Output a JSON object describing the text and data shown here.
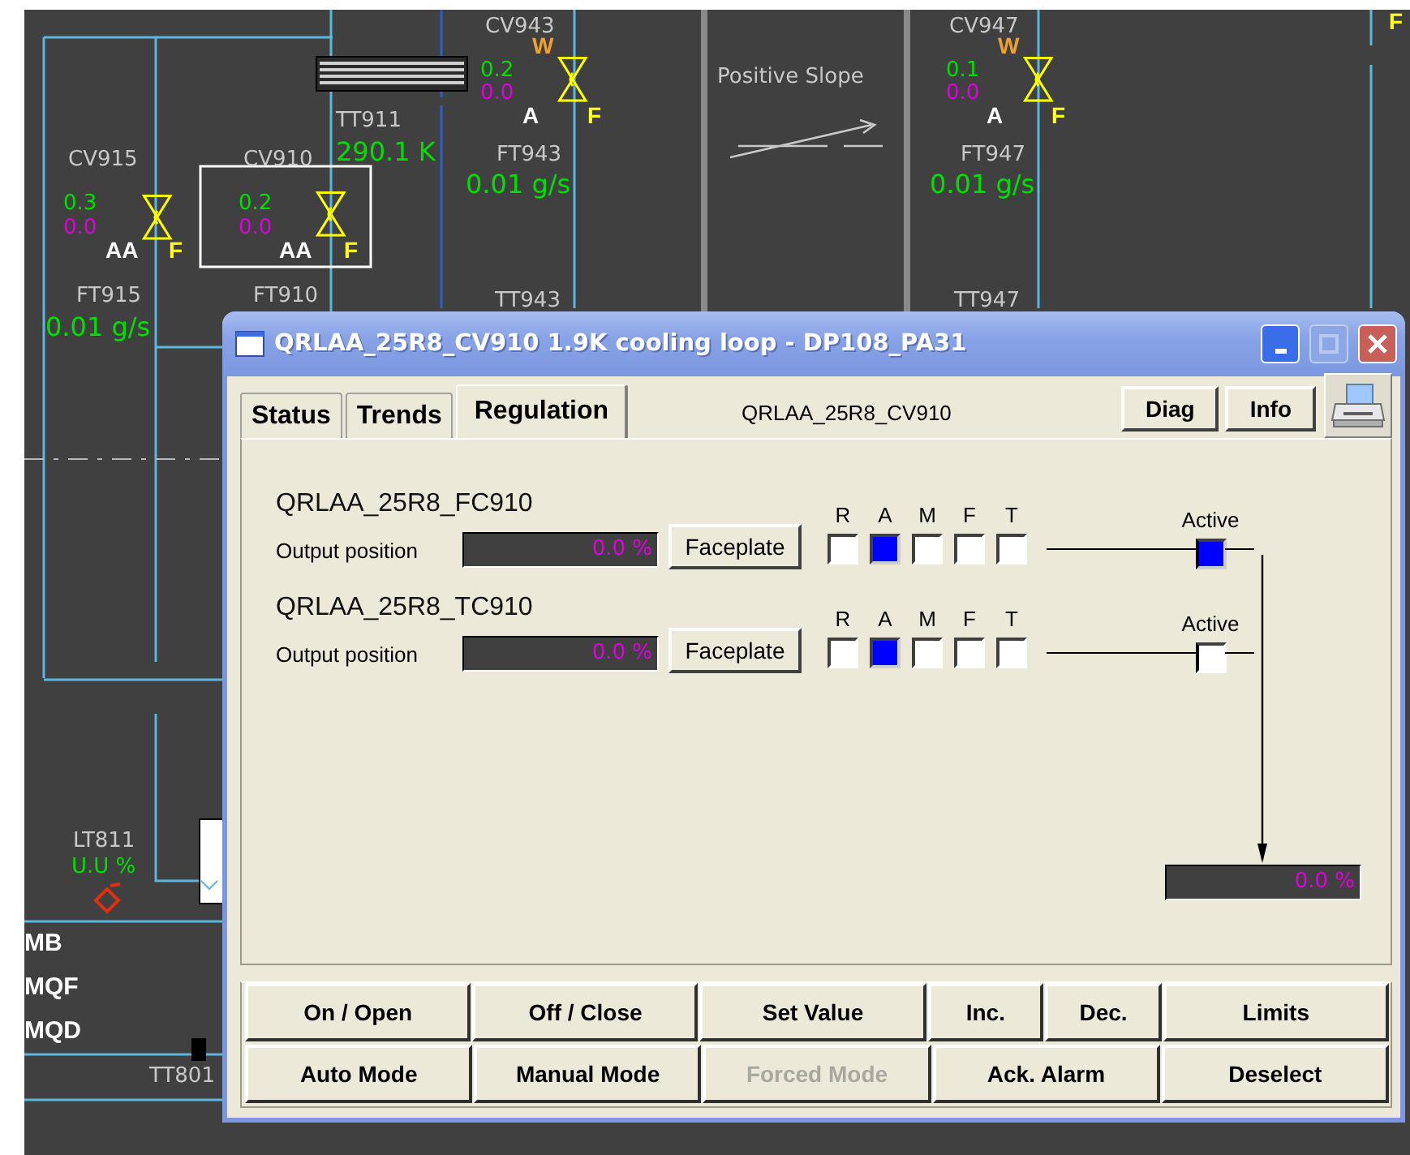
{
  "synoptic": {
    "labels": [
      {
        "kind": "tag",
        "text": "CV943"
      },
      {
        "kind": "tag",
        "text": "CV947"
      },
      {
        "kind": "fault",
        "text": "F"
      },
      {
        "kind": "warning",
        "text": "W"
      },
      {
        "kind": "warning",
        "text": "W"
      },
      {
        "kind": "reading",
        "text": "0.2"
      },
      {
        "kind": "caption",
        "text": "Positive Slope"
      },
      {
        "kind": "reading",
        "text": "0.1"
      },
      {
        "kind": "position",
        "text": "0.0"
      },
      {
        "kind": "position",
        "text": "0.0"
      },
      {
        "kind": "tag",
        "text": "TT911"
      },
      {
        "kind": "mode",
        "text": "A"
      },
      {
        "kind": "fault",
        "text": "F"
      },
      {
        "kind": "mode",
        "text": "A"
      },
      {
        "kind": "fault",
        "text": "F"
      },
      {
        "kind": "tag",
        "text": "CV915"
      },
      {
        "kind": "tag",
        "text": "CV910"
      },
      {
        "kind": "flow",
        "text": "290.1 K"
      },
      {
        "kind": "tag",
        "text": "FT943"
      },
      {
        "kind": "tag",
        "text": "FT947"
      },
      {
        "kind": "flow",
        "text": "0.01 g/s"
      },
      {
        "kind": "flow",
        "text": "0.01 g/s"
      },
      {
        "kind": "reading",
        "text": "0.3"
      },
      {
        "kind": "reading",
        "text": "0.2"
      },
      {
        "kind": "position",
        "text": "0.0"
      },
      {
        "kind": "position",
        "text": "0.0"
      },
      {
        "kind": "mode",
        "text": "AA"
      },
      {
        "kind": "fault",
        "text": "F"
      },
      {
        "kind": "mode",
        "text": "AA"
      },
      {
        "kind": "fault",
        "text": "F"
      },
      {
        "kind": "tag",
        "text": "FT915"
      },
      {
        "kind": "tag",
        "text": "FT910"
      },
      {
        "kind": "tag",
        "text": "TT943"
      },
      {
        "kind": "tag",
        "text": "TT947"
      },
      {
        "kind": "flow",
        "text": "0.01 g/s"
      },
      {
        "kind": "tag",
        "text": "LT811"
      },
      {
        "kind": "reading",
        "text": "U.U %"
      },
      {
        "kind": "section",
        "text": "MB"
      },
      {
        "kind": "section",
        "text": "MQF"
      },
      {
        "kind": "section",
        "text": "MQD"
      },
      {
        "kind": "tag",
        "text": "TT801"
      }
    ]
  },
  "window": {
    "title": "QRLAA_25R8_CV910 1.9K cooling loop - DP108_PA31",
    "maximize_disabled": true
  },
  "tabs": [
    {
      "label": "Status",
      "selected": false
    },
    {
      "label": "Trends",
      "selected": false
    },
    {
      "label": "Regulation",
      "selected": true
    }
  ],
  "object_name": "QRLAA_25R8_CV910",
  "header_buttons": [
    "Diag",
    "Info"
  ],
  "controllers": [
    {
      "name": "QRLAA_25R8_FC910",
      "output_label": "Output position",
      "output_value": "0.0 %",
      "button": "Faceplate",
      "modes": [
        {
          "label": "R",
          "on": false
        },
        {
          "label": "A",
          "on": true
        },
        {
          "label": "M",
          "on": false
        },
        {
          "label": "F",
          "on": false
        },
        {
          "label": "T",
          "on": false
        }
      ],
      "active_label": "Active",
      "active": true
    },
    {
      "name": "QRLAA_25R8_TC910",
      "output_label": "Output position",
      "output_value": "0.0 %",
      "button": "Faceplate",
      "modes": [
        {
          "label": "R",
          "on": false
        },
        {
          "label": "A",
          "on": true
        },
        {
          "label": "M",
          "on": false
        },
        {
          "label": "F",
          "on": false
        },
        {
          "label": "T",
          "on": false
        }
      ],
      "active_label": "Active",
      "active": false
    }
  ],
  "result_output": "0.0 %",
  "actions": [
    [
      {
        "label": "On / Open",
        "kind": "full",
        "disabled": false
      },
      {
        "label": "Off / Close",
        "kind": "full",
        "disabled": false
      },
      {
        "label": "Set Value",
        "kind": "full",
        "disabled": false
      },
      {
        "label": "Inc.",
        "kind": "split",
        "disabled": false
      },
      {
        "label": "Dec.",
        "kind": "split",
        "disabled": false
      },
      {
        "label": "Limits",
        "kind": "full",
        "disabled": false
      }
    ],
    [
      {
        "label": "Auto Mode",
        "kind": "full",
        "disabled": false
      },
      {
        "label": "Manual Mode",
        "kind": "full",
        "disabled": false
      },
      {
        "label": "Forced Mode",
        "kind": "full",
        "disabled": true
      },
      {
        "label": "Ack. Alarm",
        "kind": "full",
        "disabled": false
      },
      {
        "label": "Deselect",
        "kind": "full",
        "disabled": false
      }
    ]
  ]
}
